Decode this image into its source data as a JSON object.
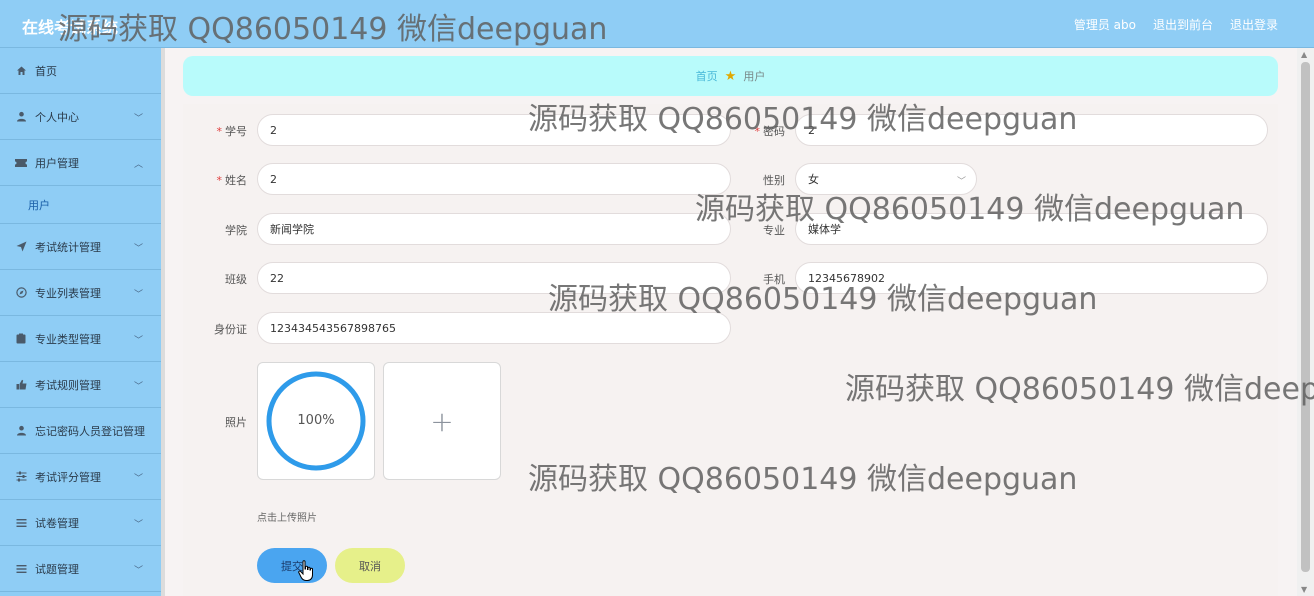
{
  "app": {
    "title": "在线考试系统"
  },
  "header_links": {
    "admin": "管理员 abo",
    "frontend": "退出到前台",
    "logout": "退出登录"
  },
  "sidebar": {
    "items": [
      {
        "label": "首页",
        "icon": "home-icon"
      },
      {
        "label": "个人中心",
        "icon": "user-icon"
      },
      {
        "label": "用户管理",
        "icon": "ticket-icon"
      },
      {
        "label": "考试统计管理",
        "icon": "send-icon"
      },
      {
        "label": "专业列表管理",
        "icon": "compass-icon"
      },
      {
        "label": "专业类型管理",
        "icon": "clipboard-icon"
      },
      {
        "label": "考试规则管理",
        "icon": "thumb-icon"
      },
      {
        "label": "忘记密码人员登记管理",
        "icon": "person-icon"
      },
      {
        "label": "考试评分管理",
        "icon": "sliders-icon"
      },
      {
        "label": "试卷管理",
        "icon": "list-icon"
      },
      {
        "label": "试题管理",
        "icon": "list-icon"
      }
    ],
    "sub_item": "用户"
  },
  "breadcrumb": {
    "home": "首页",
    "current": "用户"
  },
  "form": {
    "xuehao_label": "学号",
    "xuehao_value": "2",
    "mima_label": "密码",
    "mima_value": "2",
    "xingming_label": "姓名",
    "xingming_value": "2",
    "xingbie_label": "性别",
    "xingbie_value": "女",
    "xueyuan_label": "学院",
    "xueyuan_value": "新闻学院",
    "zhuanye_label": "专业",
    "zhuanye_value": "媒体学",
    "banji_label": "班级",
    "banji_value": "22",
    "shouji_label": "手机",
    "shouji_value": "12345678902",
    "shenfenzheng_label": "身份证",
    "shenfenzheng_value": "123434543567898765",
    "zhaopian_label": "照片",
    "upload_progress_text": "100%",
    "upload_progress": 1.0,
    "upload_add": "+",
    "upload_hint": "点击上传照片",
    "submit": "提交",
    "cancel": "取消"
  },
  "watermark": "源码获取 QQ86050149 微信deepguan",
  "colors": {
    "header_bg": "#8fcdf5",
    "breadcrumb_bg": "#b8fbfb",
    "submit_bg": "#4aa5f0",
    "cancel_bg": "#e6f08a",
    "progress": "#2e9bea",
    "required": "#e04040"
  }
}
